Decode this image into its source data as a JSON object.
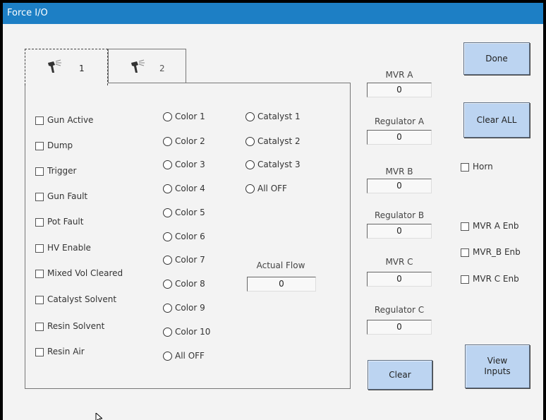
{
  "window": {
    "title": "Force I/O"
  },
  "tabs": [
    {
      "label": "1",
      "icon": "spray-gun-icon"
    },
    {
      "label": "2",
      "icon": "spray-gun-icon"
    }
  ],
  "checkboxes": [
    "Gun Active",
    "Dump",
    "Trigger",
    "Gun Fault",
    "Pot Fault",
    "HV Enable",
    "Mixed Vol Cleared",
    "Catalyst Solvent",
    "Resin Solvent",
    "Resin Air"
  ],
  "colors": [
    "Color 1",
    "Color 2",
    "Color 3",
    "Color 4",
    "Color 5",
    "Color 6",
    "Color 7",
    "Color 8",
    "Color 9",
    "Color 10",
    "All OFF"
  ],
  "catalysts": [
    "Catalyst 1",
    "Catalyst 2",
    "Catalyst 3",
    "All OFF"
  ],
  "actual_flow": {
    "label": "Actual Flow",
    "value": "0"
  },
  "readouts": [
    {
      "label": "MVR A",
      "value": "0"
    },
    {
      "label": "Regulator A",
      "value": "0"
    },
    {
      "label": "MVR B",
      "value": "0"
    },
    {
      "label": "Regulator B",
      "value": "0"
    },
    {
      "label": "MVR C",
      "value": "0"
    },
    {
      "label": "Regulator C",
      "value": "0"
    }
  ],
  "buttons": {
    "done": "Done",
    "clear_all": "Clear ALL",
    "clear": "Clear",
    "view_inputs_line1": "View",
    "view_inputs_line2": "Inputs"
  },
  "right_checkboxes": {
    "horn": "Horn",
    "mvr_a_enb": "MVR A Enb",
    "mvr_b_enb": "MVR_B Enb",
    "mvr_c_enb": "MVR C Enb"
  },
  "colors_theme": {
    "titlebar": "#1d7fc5",
    "button": "#bcd4f1",
    "background": "#f3f3f3"
  }
}
